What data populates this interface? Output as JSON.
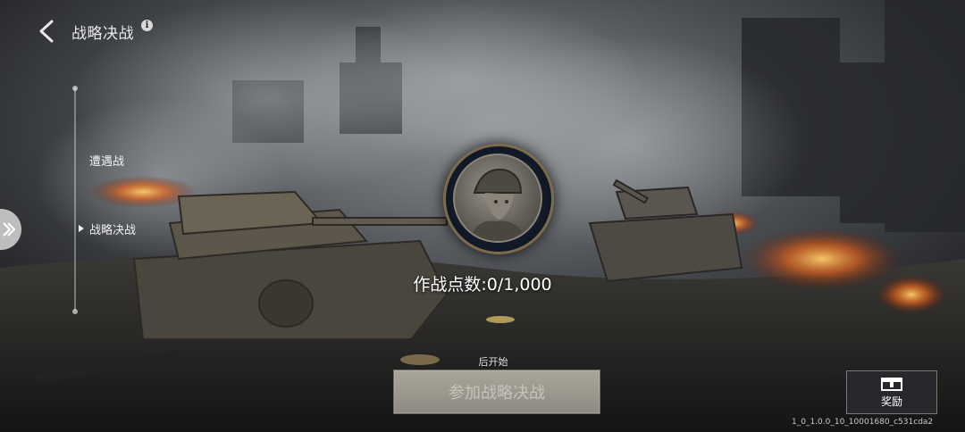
{
  "header": {
    "title": "战略决战",
    "info_glyph": "i"
  },
  "sidebar": {
    "items": [
      {
        "label": "遭遇战",
        "active": false
      },
      {
        "label": "战略决战",
        "active": true
      }
    ]
  },
  "main": {
    "points_text": "作战点数:0/1,000",
    "countdown_text": "后开始",
    "join_button_label": "参加战略决战"
  },
  "reward": {
    "label": "奖励"
  },
  "footer": {
    "version": "1_0_1.0.0_10_10001680_c531cda2"
  },
  "colors": {
    "accent": "#f0f0f0",
    "button_disabled": "#a9a59b",
    "medal_ring": "#7c6a4d"
  }
}
